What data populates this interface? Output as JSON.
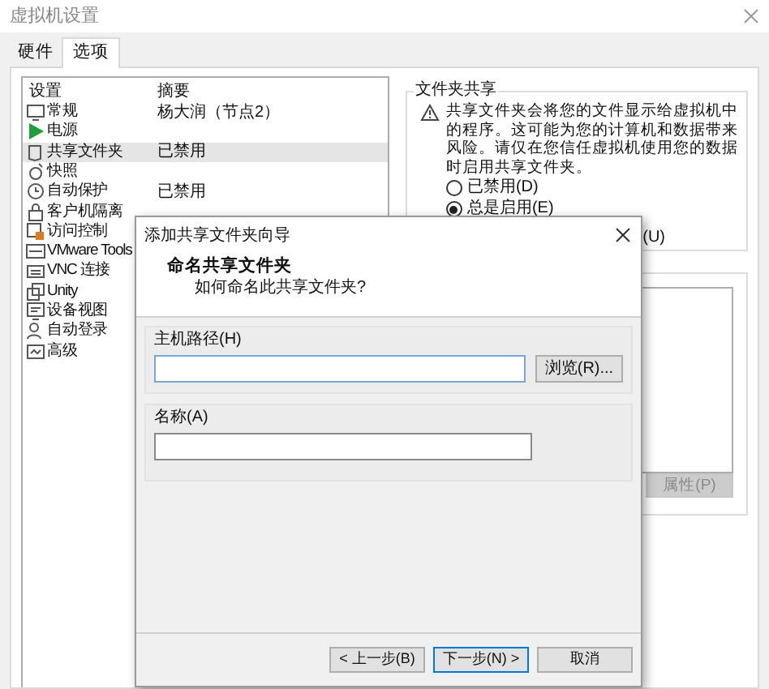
{
  "window": {
    "title": "虚拟机设置"
  },
  "tabs": [
    {
      "label": "硬件",
      "selected": false
    },
    {
      "label": "选项",
      "selected": true
    }
  ],
  "settings": {
    "columns": [
      "设置",
      "摘要"
    ],
    "rows": [
      {
        "name": "常规",
        "summary": "杨大润（节点2）",
        "selected": false
      },
      {
        "name": "电源",
        "selected": false
      },
      {
        "name": "共享文件夹",
        "summary": "已禁用",
        "selected": true
      },
      {
        "name": "快照",
        "selected": false
      },
      {
        "name": "自动保护",
        "summary": "已禁用",
        "selected": false
      },
      {
        "name": "客户机隔离",
        "selected": false
      },
      {
        "name": "访问控制",
        "selected": false
      },
      {
        "name": "VMware Tools",
        "selected": false
      },
      {
        "name": "VNC 连接",
        "selected": false
      },
      {
        "name": "Unity",
        "selected": false
      },
      {
        "name": "设备视图",
        "selected": false
      },
      {
        "name": "自动登录",
        "selected": false
      },
      {
        "name": "高级",
        "selected": false
      }
    ]
  },
  "folder_sharing": {
    "title": "文件夹共享",
    "warning": "共享文件夹会将您的文件显示给虚拟机中的程序。这可能为您的计算机和数据带来风险。请仅在您信任虚拟机使用您的数据时启用共享文件夹。",
    "options": [
      {
        "label": "已禁用(D)",
        "selected": false
      },
      {
        "label": "总是启用(E)",
        "selected": true
      }
    ],
    "partial_option": "(U)"
  },
  "folders": {
    "properties_button": {
      "label": "属性(P)",
      "disabled": true
    }
  },
  "dialog": {
    "title": "添加共享文件夹向导",
    "heading": "命名共享文件夹",
    "subheading": "如何命名此共享文件夹?",
    "host_path": {
      "label": "主机路径(H)",
      "browse": "浏览(R)..."
    },
    "name": {
      "label": "名称(A)"
    },
    "buttons": [
      {
        "label": "< 上一步(B)",
        "default": false
      },
      {
        "label": "下一步(N) >",
        "default": true
      },
      {
        "label": "取消",
        "default": false
      }
    ]
  }
}
